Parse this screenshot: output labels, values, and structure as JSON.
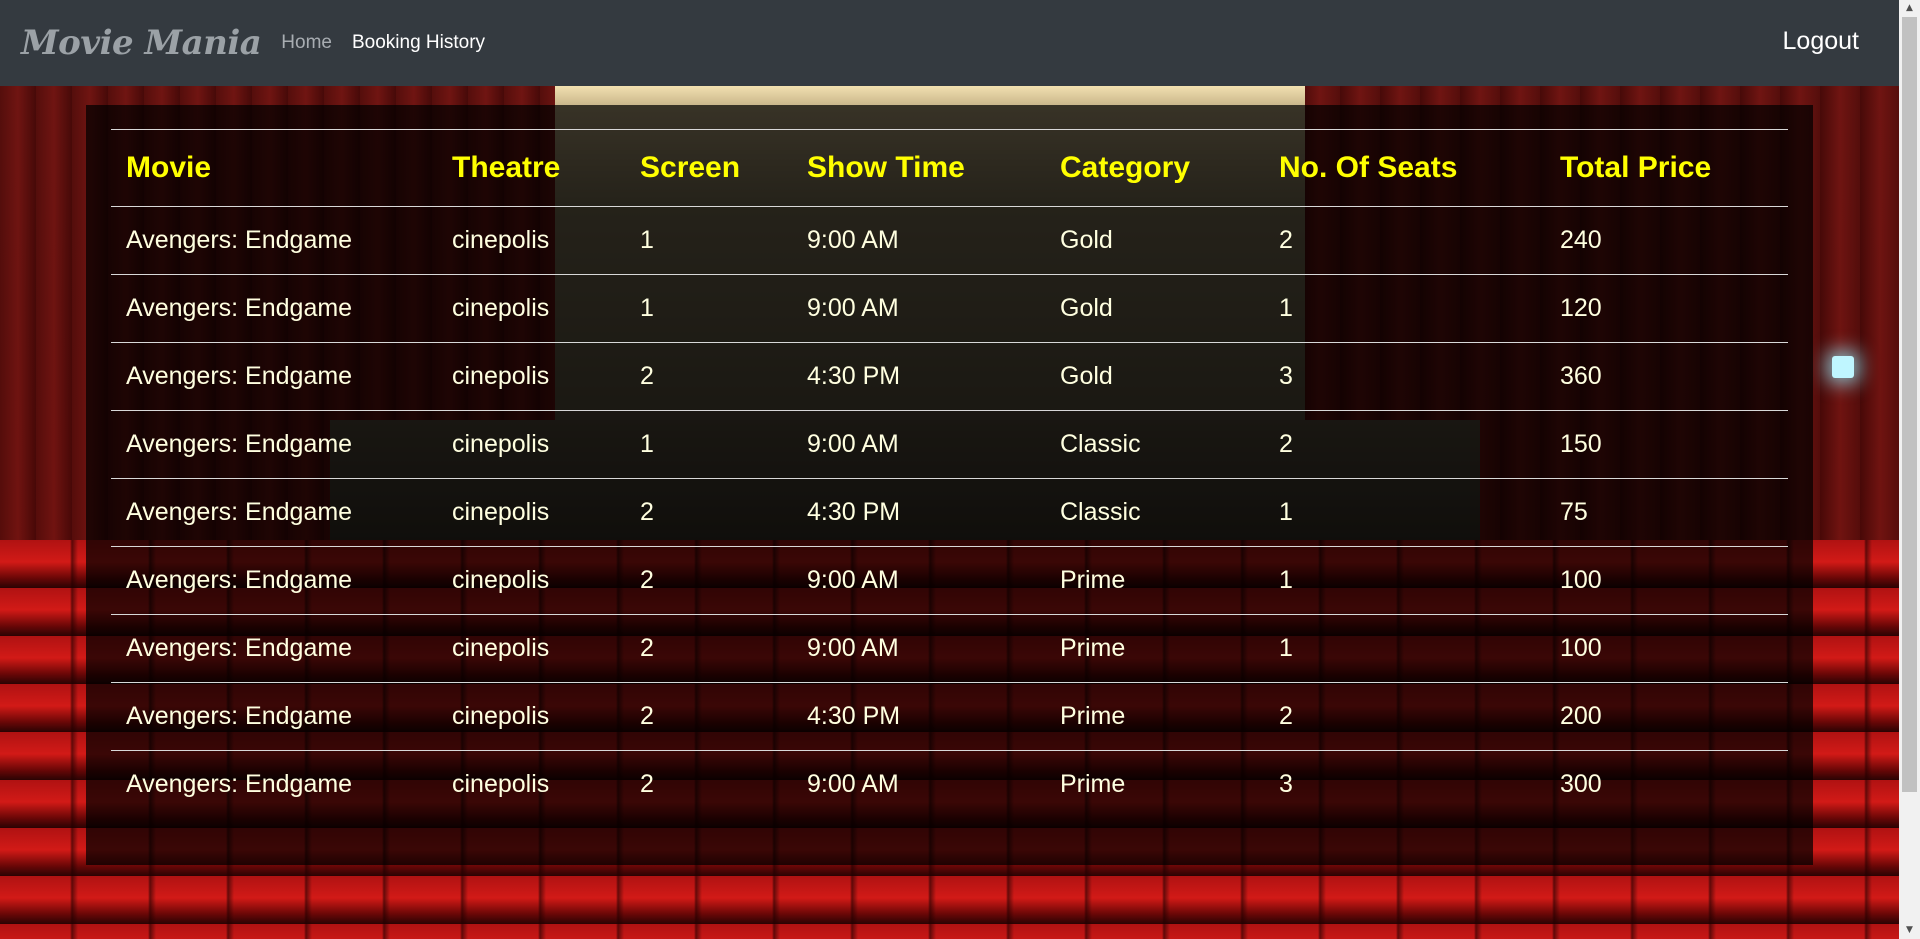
{
  "navbar": {
    "brand": "Movie Mania",
    "links": [
      {
        "label": "Home"
      },
      {
        "label": "Booking History"
      }
    ],
    "logout_label": "Logout"
  },
  "bookings": {
    "columns": [
      "Movie",
      "Theatre",
      "Screen",
      "Show Time",
      "Category",
      "No. Of Seats",
      "Total Price"
    ],
    "rows": [
      [
        "Avengers: Endgame",
        "cinepolis",
        "1",
        "9:00 AM",
        "Gold",
        "2",
        "240"
      ],
      [
        "Avengers: Endgame",
        "cinepolis",
        "1",
        "9:00 AM",
        "Gold",
        "1",
        "120"
      ],
      [
        "Avengers: Endgame",
        "cinepolis",
        "2",
        "4:30 PM",
        "Gold",
        "3",
        "360"
      ],
      [
        "Avengers: Endgame",
        "cinepolis",
        "1",
        "9:00 AM",
        "Classic",
        "2",
        "150"
      ],
      [
        "Avengers: Endgame",
        "cinepolis",
        "2",
        "4:30 PM",
        "Classic",
        "1",
        "75"
      ],
      [
        "Avengers: Endgame",
        "cinepolis",
        "2",
        "9:00 AM",
        "Prime",
        "1",
        "100"
      ],
      [
        "Avengers: Endgame",
        "cinepolis",
        "2",
        "9:00 AM",
        "Prime",
        "1",
        "100"
      ],
      [
        "Avengers: Endgame",
        "cinepolis",
        "2",
        "4:30 PM",
        "Prime",
        "2",
        "200"
      ],
      [
        "Avengers: Endgame",
        "cinepolis",
        "2",
        "9:00 AM",
        "Prime",
        "3",
        "300"
      ]
    ]
  },
  "colors": {
    "navbar_bg": "#343a40",
    "header_text": "#ffff00",
    "cell_text": "#ffffe0",
    "panel_bg": "rgba(0,0,0,0.72)"
  },
  "icons": {
    "scroll_up": "scroll-up-arrow-icon",
    "scroll_down": "scroll-down-arrow-icon"
  }
}
